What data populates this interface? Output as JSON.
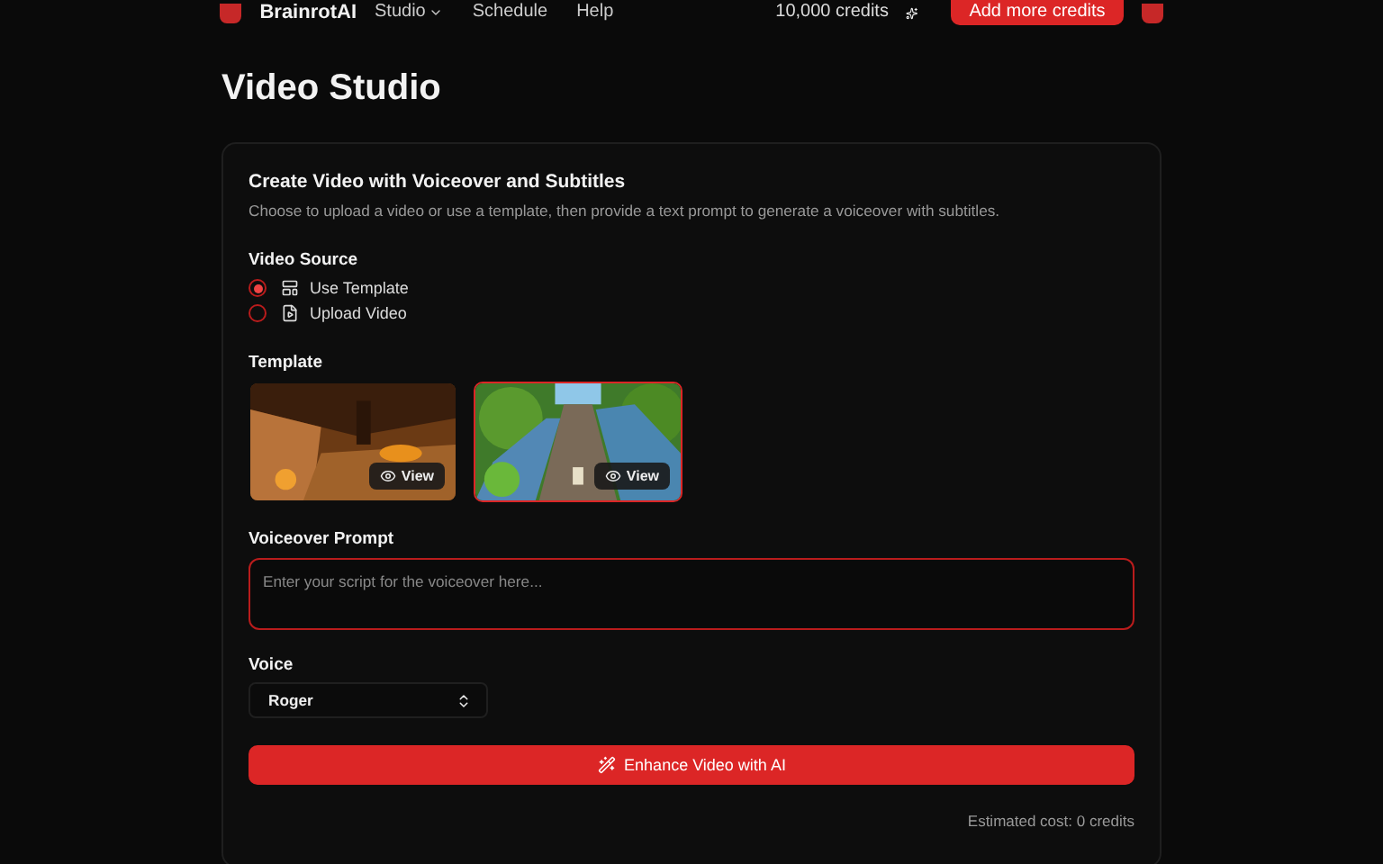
{
  "header": {
    "brand": "BrainrotAI",
    "nav": [
      {
        "label": "Studio",
        "dropdown": true
      },
      {
        "label": "Schedule",
        "dropdown": false
      },
      {
        "label": "Help",
        "dropdown": false
      }
    ],
    "credits": "10,000 credits",
    "cta": "Add more credits"
  },
  "page_title": "Video Studio",
  "card": {
    "title": "Create Video with Voiceover and Subtitles",
    "description": "Choose to upload a video or use a template, then provide a text prompt to generate a voiceover with subtitles.",
    "source_label": "Video Source",
    "sources": [
      {
        "label": "Use Template",
        "kind": "template",
        "selected": true
      },
      {
        "label": "Upload Video",
        "kind": "upload",
        "selected": false
      }
    ],
    "template_label": "Template",
    "templates": [
      {
        "kind": "cave",
        "view": "View",
        "selected": false
      },
      {
        "kind": "runner",
        "view": "View",
        "selected": true
      }
    ],
    "prompt_label": "Voiceover Prompt",
    "prompt": {
      "placeholder": "Enter your script for the voiceover here..."
    },
    "voice_label": "Voice",
    "voice": "Roger",
    "submit": "Enhance Video with AI",
    "cost": "Estimated cost: 0 credits"
  }
}
